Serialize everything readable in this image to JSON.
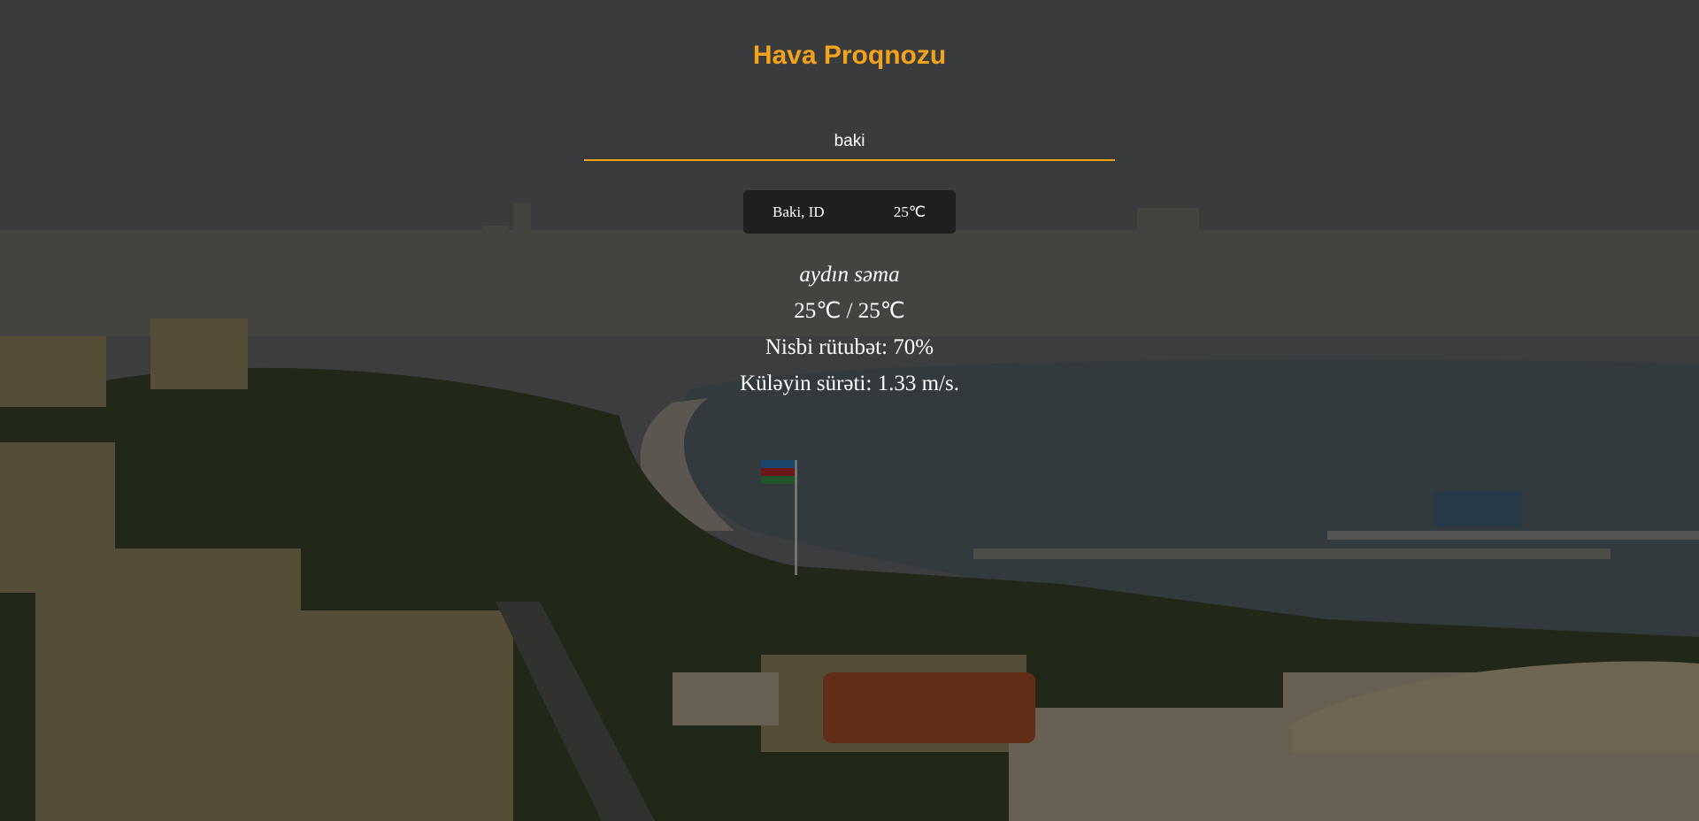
{
  "app": {
    "title": "Hava Proqnozu"
  },
  "search": {
    "value": "baki",
    "placeholder": ""
  },
  "result": {
    "location": "Baki, ID",
    "temperature": "25℃"
  },
  "details": {
    "description": "aydın səma",
    "temp_range": "25℃ / 25℃",
    "humidity": "Nisbi rütubət: 70%",
    "wind": "Küləyin sürəti: 1.33 m/s."
  },
  "colors": {
    "accent": "#f5a31a",
    "chip_bg": "#1f1f1f",
    "text": "#ffffff"
  }
}
